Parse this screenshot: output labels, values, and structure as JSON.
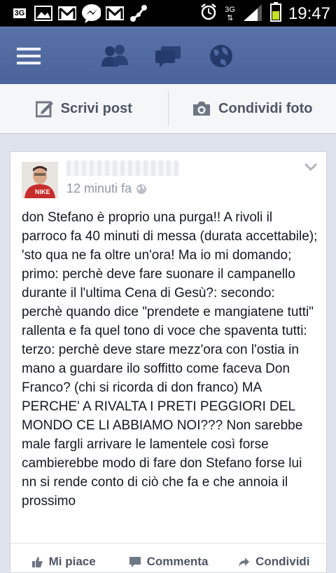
{
  "status_bar": {
    "network_badge": "3G",
    "signal_label": "3G",
    "time": "19:47",
    "notification_icons": [
      "image-icon",
      "gmail-icon",
      "messenger-icon",
      "gmail-icon",
      "share-icon"
    ]
  },
  "nav": {
    "items": [
      "menu-icon",
      "friends-icon",
      "messages-icon",
      "globe-icon"
    ],
    "color": "#4b649c"
  },
  "composer": {
    "write_post": "Scrivi post",
    "share_photo": "Condividi foto"
  },
  "post": {
    "time": "12 minuti fa",
    "body": "don Stefano è proprio una purga!! A rivoli il parroco fa 40 minuti di messa (durata accettabile); 'sto qua ne fa oltre un'ora! Ma io mi domando; primo: perchè deve fare suonare il campanello durante il l'ultima Cena di Gesù?: secondo: perchè quando dice \"prendete e mangiatene tutti\" rallenta e fa quel tono di voce che spaventa tutti: terzo: perchè deve stare mezz'ora con l'ostia in mano a guardare ilo soffitto come faceva Don Franco? (chi si ricorda di don franco) MA PERCHE' A RIVALTA I PRETI PEGGIORI DEL MONDO CE LI ABBIAMO NOI??? Non sarebbe male fargli arrivare le lamentele così forse cambierebbe modo di fare don Stefano forse lui nn si rende conto di ciò che fa e che annoia il prossimo",
    "actions": {
      "like": "Mi piace",
      "comment": "Commenta",
      "share": "Condividi"
    }
  }
}
